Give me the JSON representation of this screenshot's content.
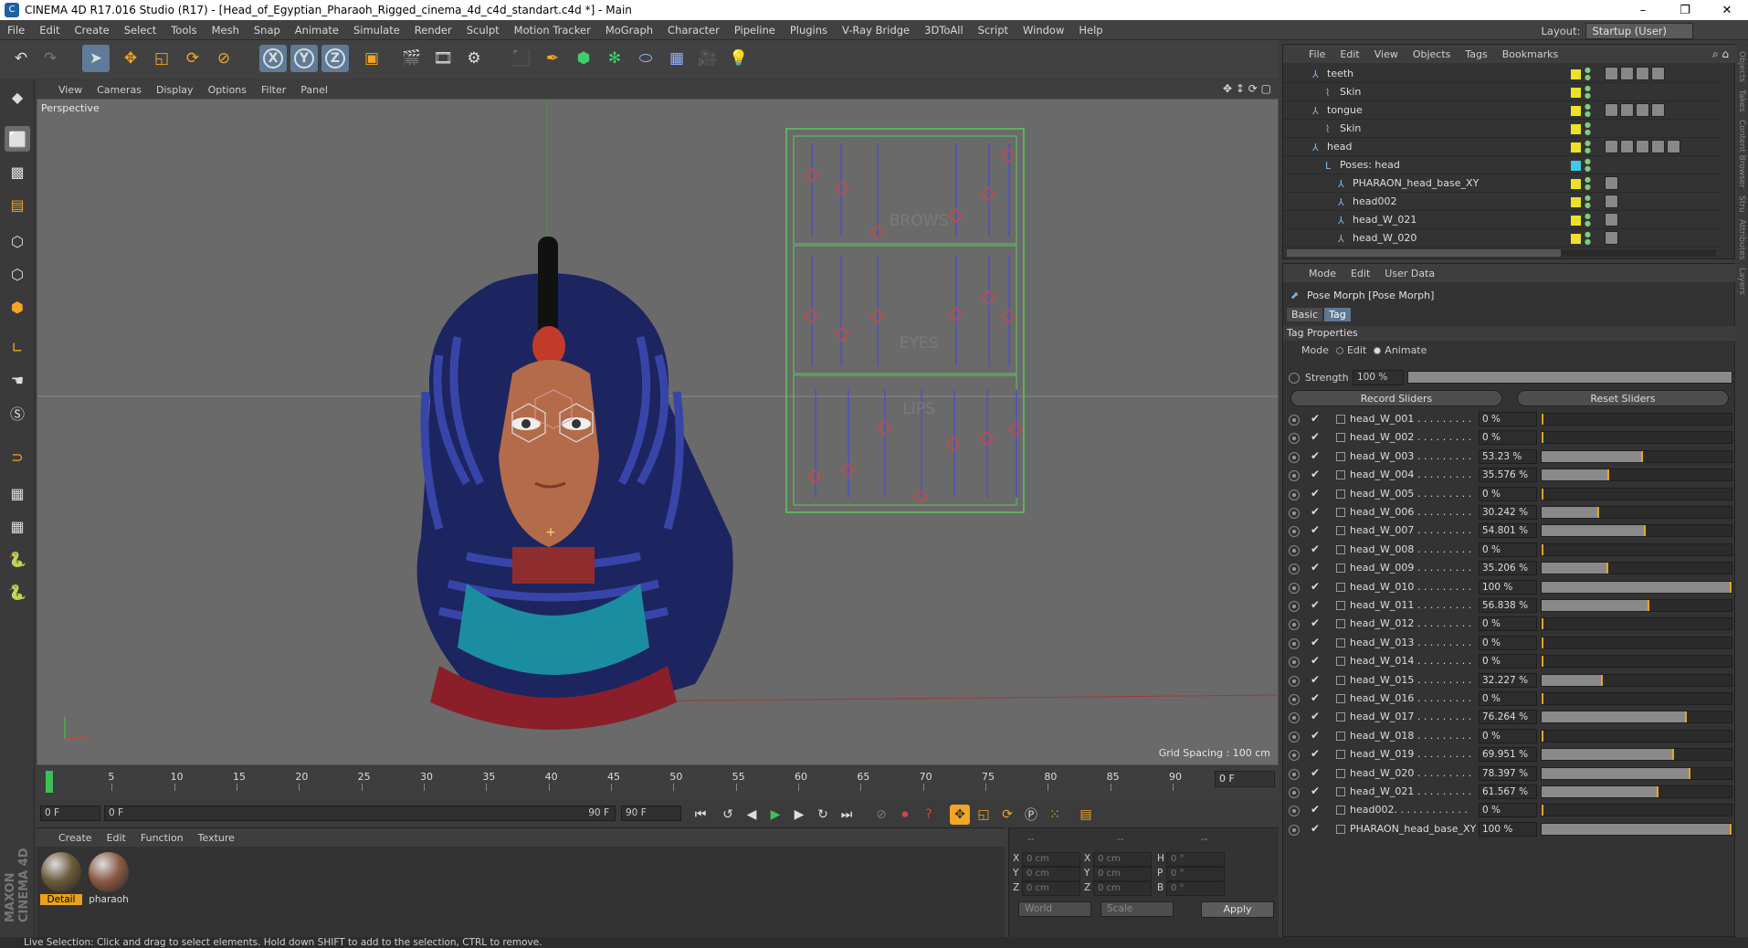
{
  "window": {
    "title": "CINEMA 4D R17.016 Studio (R17) - [Head_of_Egyptian_Pharaoh_Rigged_cinema_4d_c4d_standart.c4d *] - Main",
    "min": "–",
    "max": "❐",
    "close": "✕"
  },
  "menubar": {
    "items": [
      "File",
      "Edit",
      "Create",
      "Select",
      "Tools",
      "Mesh",
      "Snap",
      "Animate",
      "Simulate",
      "Render",
      "Sculpt",
      "Motion Tracker",
      "MoGraph",
      "Character",
      "Pipeline",
      "Plugins",
      "V-Ray Bridge",
      "3DToAll",
      "Script",
      "Window",
      "Help"
    ],
    "layout_label": "Layout:",
    "layout_value": "Startup (User)"
  },
  "viewport": {
    "menu": [
      "View",
      "Cameras",
      "Display",
      "Options",
      "Filter",
      "Panel"
    ],
    "label": "Perspective",
    "grid_spacing": "Grid Spacing : 100 cm",
    "panel_labels": [
      "BROWS",
      "EYES",
      "LIPS"
    ]
  },
  "timeline": {
    "ticks": [
      "0",
      "5",
      "10",
      "15",
      "20",
      "25",
      "30",
      "35",
      "40",
      "45",
      "50",
      "55",
      "60",
      "65",
      "70",
      "75",
      "80",
      "85",
      "90"
    ],
    "current_frame": "0 F"
  },
  "transport": {
    "start": "0 F",
    "range_start": "0 F",
    "range_end": "90 F",
    "end": "90 F"
  },
  "material_manager": {
    "menu": [
      "Create",
      "Edit",
      "Function",
      "Texture"
    ],
    "materials": [
      {
        "name": "Detail",
        "selected": true,
        "color": "#6b5b3a"
      },
      {
        "name": "pharaoh",
        "selected": false,
        "color": "#8c5a44"
      }
    ]
  },
  "coordinates": {
    "headers": [
      "--",
      "--",
      "--"
    ],
    "rows": [
      {
        "a": "X",
        "av": "0 cm",
        "b": "X",
        "bv": "0 cm",
        "c": "H",
        "cv": "0 °"
      },
      {
        "a": "Y",
        "av": "0 cm",
        "b": "Y",
        "bv": "0 cm",
        "c": "P",
        "cv": "0 °"
      },
      {
        "a": "Z",
        "av": "0 cm",
        "b": "Z",
        "bv": "0 cm",
        "c": "B",
        "cv": "0 °"
      }
    ],
    "world": "World",
    "scale": "Scale",
    "apply": "Apply"
  },
  "status": "Live Selection: Click and drag to select elements. Hold down SHIFT to add to the selection, CTRL to remove.",
  "object_manager": {
    "menu": [
      "File",
      "Edit",
      "View",
      "Objects",
      "Tags",
      "Bookmarks"
    ],
    "rows": [
      {
        "name": "teeth",
        "indent": 1,
        "type": "bone",
        "swatch": "ylw",
        "tags": 4
      },
      {
        "name": "Skin",
        "indent": 2,
        "type": "skin",
        "swatch": "ylw",
        "tags": 0
      },
      {
        "name": "tongue",
        "indent": 1,
        "type": "bone",
        "swatch": "ylw",
        "tags": 4
      },
      {
        "name": "Skin",
        "indent": 2,
        "type": "skin",
        "swatch": "ylw",
        "tags": 0
      },
      {
        "name": "head",
        "indent": 1,
        "type": "bone",
        "swatch": "ylw",
        "tags": 5
      },
      {
        "name": "Poses: head",
        "indent": 2,
        "type": "null",
        "swatch": "cyn",
        "tags": 0
      },
      {
        "name": "PHARAON_head_base_XY",
        "indent": 3,
        "type": "bone",
        "swatch": "ylw",
        "tags": 1
      },
      {
        "name": "head002",
        "indent": 3,
        "type": "bone",
        "swatch": "ylw",
        "tags": 1
      },
      {
        "name": "head_W_021",
        "indent": 3,
        "type": "bone",
        "swatch": "ylw",
        "tags": 1
      },
      {
        "name": "head_W_020",
        "indent": 3,
        "type": "bone",
        "swatch": "ylw",
        "tags": 1
      }
    ]
  },
  "attributes": {
    "menu": [
      "Mode",
      "Edit",
      "User Data"
    ],
    "title": "Pose Morph [Pose Morph]",
    "tabs": [
      "Basic",
      "Tag"
    ],
    "section": "Tag Properties",
    "mode_label": "Mode",
    "mode_edit": "Edit",
    "mode_animate": "Animate",
    "strength_label": "Strength",
    "strength_value": "100 %",
    "record": "Record Sliders",
    "reset": "Reset Sliders",
    "morphs": [
      {
        "name": "head_W_001 . . . . . . . . .",
        "value": "0 %",
        "pct": 0
      },
      {
        "name": "head_W_002 . . . . . . . . .",
        "value": "0 %",
        "pct": 0
      },
      {
        "name": "head_W_003 . . . . . . . . .",
        "value": "53.23 %",
        "pct": 53.23
      },
      {
        "name": "head_W_004 . . . . . . . . .",
        "value": "35.576 %",
        "pct": 35.576
      },
      {
        "name": "head_W_005 . . . . . . . . .",
        "value": "0 %",
        "pct": 0
      },
      {
        "name": "head_W_006 . . . . . . . . .",
        "value": "30.242 %",
        "pct": 30.242
      },
      {
        "name": "head_W_007 . . . . . . . . .",
        "value": "54.801 %",
        "pct": 54.801
      },
      {
        "name": "head_W_008 . . . . . . . . .",
        "value": "0 %",
        "pct": 0
      },
      {
        "name": "head_W_009 . . . . . . . . .",
        "value": "35.206 %",
        "pct": 35.206
      },
      {
        "name": "head_W_010 . . . . . . . . .",
        "value": "100 %",
        "pct": 100
      },
      {
        "name": "head_W_011 . . . . . . . . .",
        "value": "56.838 %",
        "pct": 56.838
      },
      {
        "name": "head_W_012 . . . . . . . . .",
        "value": "0 %",
        "pct": 0
      },
      {
        "name": "head_W_013 . . . . . . . . .",
        "value": "0 %",
        "pct": 0
      },
      {
        "name": "head_W_014 . . . . . . . . .",
        "value": "0 %",
        "pct": 0
      },
      {
        "name": "head_W_015 . . . . . . . . .",
        "value": "32.227 %",
        "pct": 32.227
      },
      {
        "name": "head_W_016 . . . . . . . . .",
        "value": "0 %",
        "pct": 0
      },
      {
        "name": "head_W_017 . . . . . . . . .",
        "value": "76.264 %",
        "pct": 76.264
      },
      {
        "name": "head_W_018 . . . . . . . . .",
        "value": "0 %",
        "pct": 0
      },
      {
        "name": "head_W_019 . . . . . . . . .",
        "value": "69.951 %",
        "pct": 69.951
      },
      {
        "name": "head_W_020 . . . . . . . . .",
        "value": "78.397 %",
        "pct": 78.397
      },
      {
        "name": "head_W_021 . . . . . . . . .",
        "value": "61.567 %",
        "pct": 61.567
      },
      {
        "name": "head002. . . . . . . . . . . .",
        "value": "0 %",
        "pct": 0
      },
      {
        "name": "PHARAON_head_base_XY",
        "value": "100 %",
        "pct": 100
      }
    ]
  },
  "side_tabs": [
    "Objects",
    "Takes",
    "Content Browser",
    "Stru",
    "Attributes",
    "Layers"
  ],
  "colors": {
    "accent": "#e8a526",
    "selection": "#5f7b97",
    "viewport": "#6a6a6a"
  }
}
